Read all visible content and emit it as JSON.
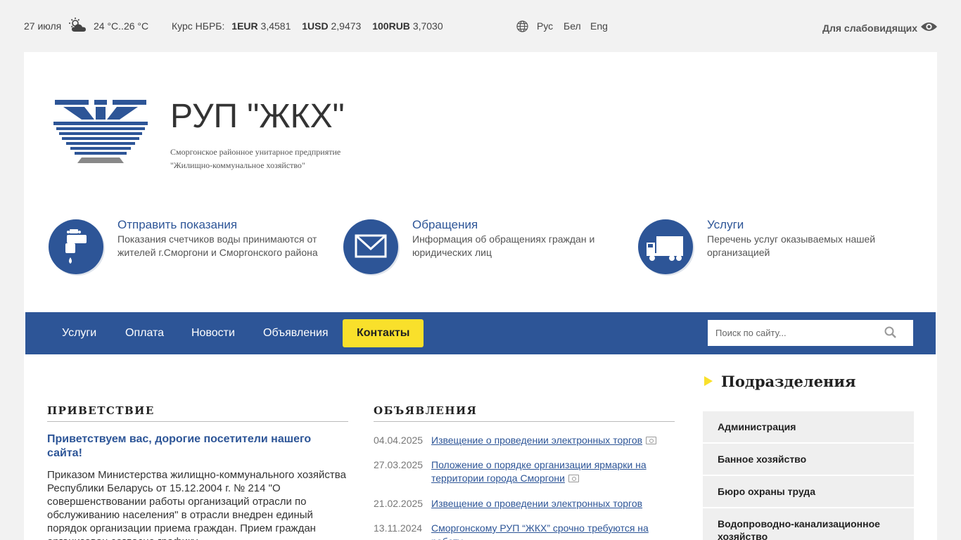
{
  "topbar": {
    "date": "27 июля",
    "temp": "24 °C..26 °C",
    "rates_label": "Курс НБРБ:",
    "rates": [
      {
        "code": "1EUR",
        "value": "3,4581"
      },
      {
        "code": "1USD",
        "value": "2,9473"
      },
      {
        "code": "100RUB",
        "value": "3,7030"
      }
    ],
    "languages": [
      "Рус",
      "Бел",
      "Eng"
    ],
    "accessibility": "Для слабовидящих"
  },
  "header": {
    "title": "РУП \"ЖКХ\"",
    "subtitle_line1": "Сморгонское районное унитарное предприятие",
    "subtitle_line2": "\"Жилищно-коммунальное хозяйство\""
  },
  "features": [
    {
      "title": "Отправить показания",
      "desc": "Показания счетчиков воды принимаются от жителей г.Сморгони и Сморгонского района",
      "icon": "water-tap-icon"
    },
    {
      "title": "Обращения",
      "desc": "Информация об обращениях граждан и юридических лиц",
      "icon": "envelope-icon"
    },
    {
      "title": "Услуги",
      "desc": "Перечень услуг оказываемых нашей организацией",
      "icon": "truck-icon"
    }
  ],
  "nav": {
    "items": [
      "Услуги",
      "Оплата",
      "Новости",
      "Объявления",
      "Контакты"
    ],
    "active_index": 4,
    "search_placeholder": "Поиск по сайту..."
  },
  "welcome": {
    "heading": "ПРИВЕТСТВИЕ",
    "title": "Приветствуем вас, дорогие посетители нашего сайта!",
    "text": "Приказом Министерства жилищно-коммунального хозяйства Республики Беларусь от 15.12.2004 г. № 214 \"О совершенствовании работы организаций отрасли по обслуживанию населения\" в отрасли внедрен единый порядок организации приема граждан. Прием граждан организован согласно графику"
  },
  "announcements": {
    "heading": "ОБЪЯВЛЕНИЯ",
    "items": [
      {
        "date": "04.04.2025",
        "text": "Извещение о проведении электронных торгов",
        "has_image": true
      },
      {
        "date": "27.03.2025",
        "text": "Положение о порядке организации ярмарки на территории города Сморгони",
        "has_image": true
      },
      {
        "date": "21.02.2025",
        "text": "Извещение о проведении электронных торгов",
        "has_image": false
      },
      {
        "date": "13.11.2024",
        "text": "Сморгонскому РУП “ЖКХ” срочно требуются на работу",
        "has_image": false
      }
    ]
  },
  "sidebar": {
    "title": "Подразделения",
    "items": [
      "Администрация",
      "Банное хозяйство",
      "Бюро охраны труда",
      "Водопроводно-канализационное хозяйство"
    ]
  },
  "colors": {
    "brand_blue": "#2d5597",
    "accent_yellow": "#f9e02b"
  }
}
